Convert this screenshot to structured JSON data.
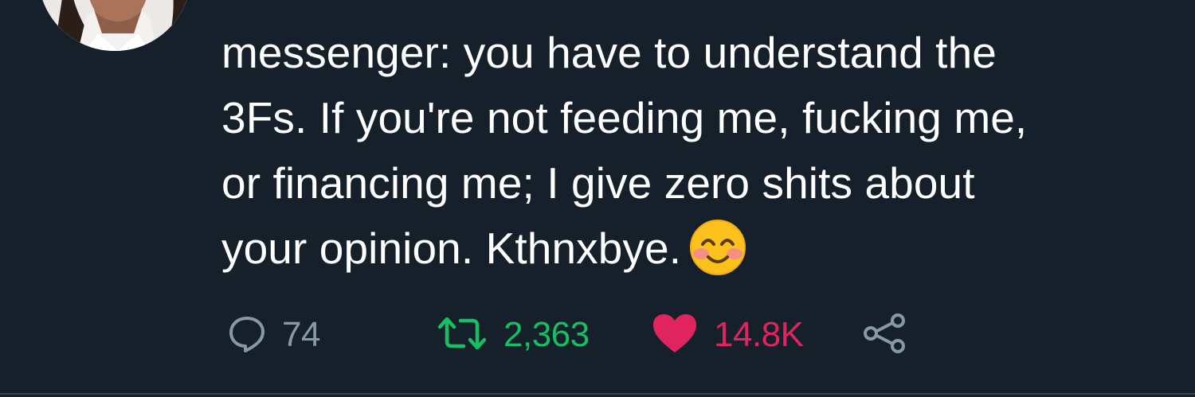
{
  "tweet": {
    "text_lines": [
      "messenger: you have to understand the",
      "3Fs. If you're not feeding me, fucking me,",
      "or financing me; I give zero shits about",
      "your opinion. Kthnxbye."
    ],
    "emoji": "smiling-face-with-smiling-eyes-emoji"
  },
  "actions": {
    "reply_count": "74",
    "retweet_count": "2,363",
    "like_count": "14.8K",
    "icons": {
      "reply": "speech-bubble-icon",
      "retweet": "retweet-icon",
      "like": "heart-icon",
      "share": "share-icon"
    }
  },
  "colors": {
    "background": "#15202b",
    "text": "#ffffff",
    "muted": "#8899a6",
    "retweet": "#17bf63",
    "like": "#e0245e"
  }
}
